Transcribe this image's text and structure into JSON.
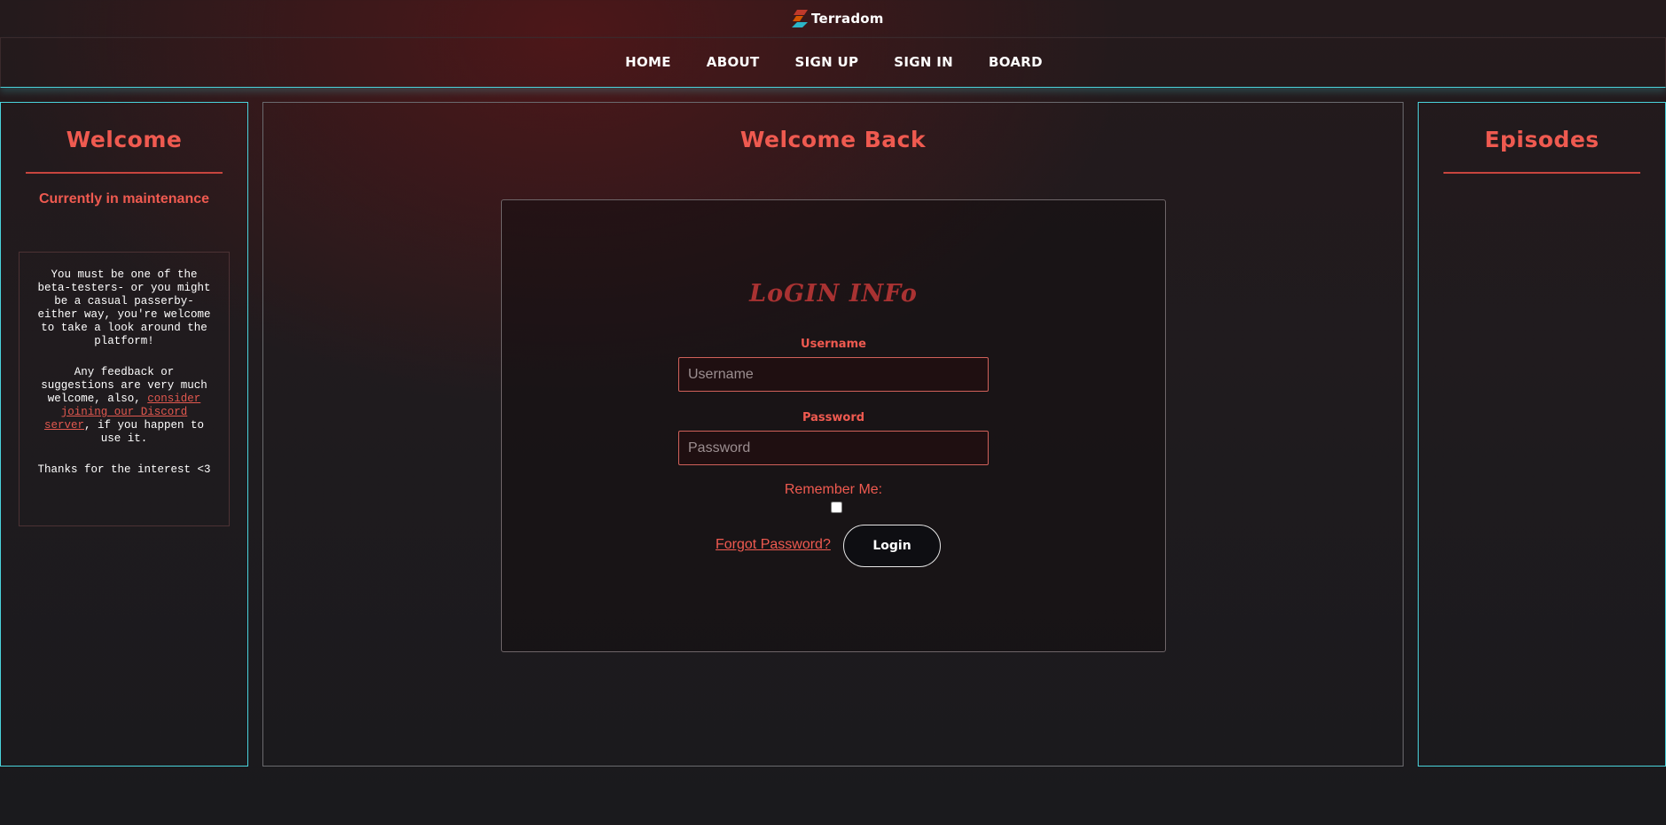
{
  "brand": {
    "name": "Terradom",
    "logo_icon": "terradom-logo-icon"
  },
  "nav": {
    "items": [
      {
        "label": "HOME"
      },
      {
        "label": "ABOUT"
      },
      {
        "label": "SIGN UP"
      },
      {
        "label": "SIGN IN"
      },
      {
        "label": "BOARD"
      }
    ]
  },
  "left_panel": {
    "title": "Welcome",
    "status": "Currently in maintenance",
    "notice": {
      "p1": "You must be one of the beta-testers- or you might be a casual passerby- either way, you're welcome to take a look around the platform!",
      "p2_before": "Any feedback or suggestions are very much welcome, also, ",
      "p2_link": "consider joining our Discord server",
      "p2_after": ", if you happen to use it.",
      "p3": "Thanks for the interest <3"
    }
  },
  "center_panel": {
    "title": "Welcome Back",
    "login": {
      "heading": "LoGIN INFo",
      "username_label": "Username",
      "username_placeholder": "Username",
      "username_value": "",
      "password_label": "Password",
      "password_placeholder": "Password",
      "password_value": "",
      "remember_label": "Remember Me:",
      "remember_checked": false,
      "forgot_label": "Forgot Password?",
      "submit_label": "Login"
    }
  },
  "right_panel": {
    "title": "Episodes"
  },
  "colors": {
    "accent": "#ef5a50",
    "panel_border": "#4ad3dc",
    "heading_dark_red": "#a93232"
  }
}
